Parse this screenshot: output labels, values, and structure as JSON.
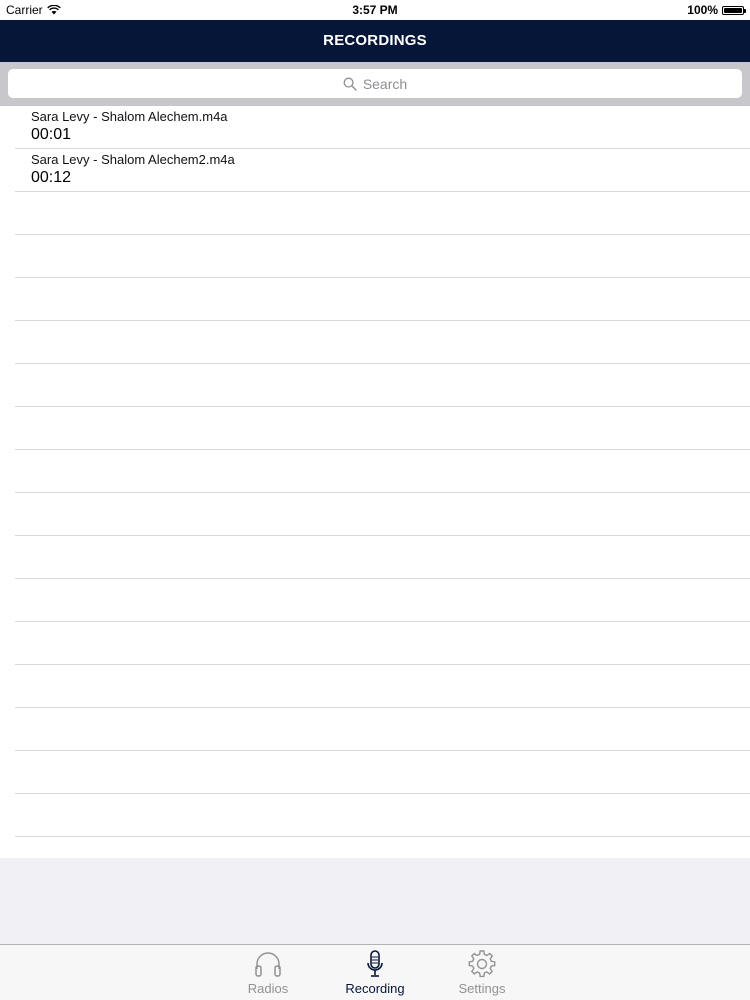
{
  "status_bar": {
    "carrier": "Carrier",
    "time": "3:57 PM",
    "battery": "100%"
  },
  "nav": {
    "title": "RECORDINGS"
  },
  "search": {
    "placeholder": "Search"
  },
  "recordings": [
    {
      "name": "Sara Levy - Shalom Alechem.m4a",
      "duration": "00:01"
    },
    {
      "name": "Sara Levy - Shalom Alechem2.m4a",
      "duration": "00:12"
    }
  ],
  "tabs": [
    {
      "label": "Radios",
      "icon": "headphones-icon",
      "active": false
    },
    {
      "label": "Recording",
      "icon": "microphone-icon",
      "active": true
    },
    {
      "label": "Settings",
      "icon": "gear-icon",
      "active": false
    }
  ],
  "colors": {
    "nav_bar": "#061638",
    "active_tab": "#061638",
    "inactive_tab": "#929292"
  }
}
